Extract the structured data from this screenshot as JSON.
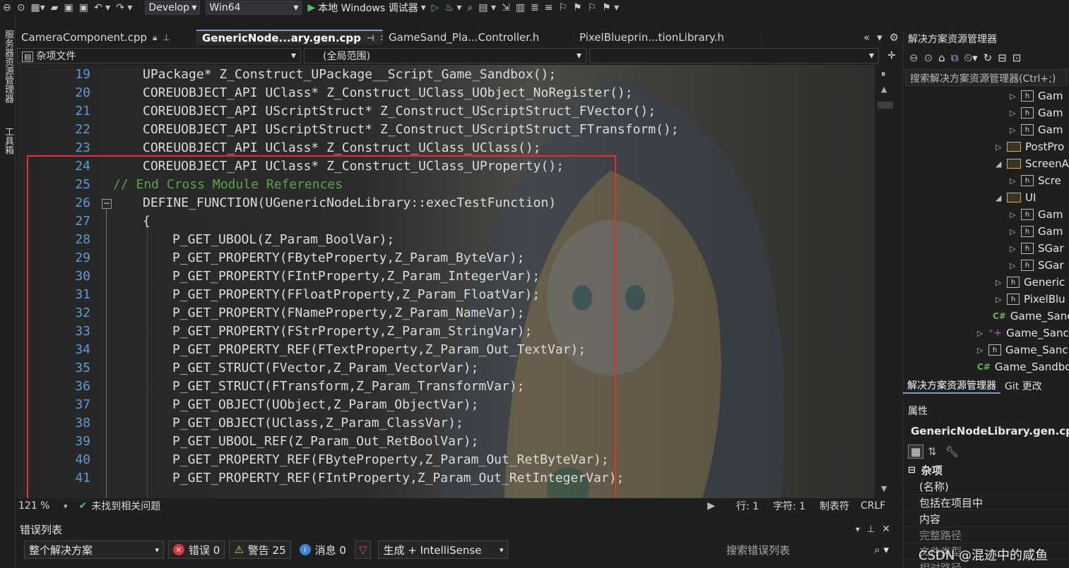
{
  "toolbar": {
    "config": "Develop",
    "platform": "Win64",
    "run_label": "本地 Windows 调试器"
  },
  "left_strip": {
    "item1": "服务器资源管理器",
    "item2": "工具箱"
  },
  "tabs": [
    {
      "label": "CameraComponent.cpp"
    },
    {
      "label": "GenericNode...ary.gen.cpp"
    },
    {
      "label": "GameSand_Pla...Controller.h"
    },
    {
      "label": "PixelBlueprin...tionLibrary.h"
    }
  ],
  "navbar": {
    "file_scope": "杂项文件",
    "global_scope": "(全局范围)"
  },
  "editor": {
    "lines": [
      {
        "n": "19",
        "code": "UPackage* Z_Construct_UPackage__Script_Game_Sandbox();"
      },
      {
        "n": "20",
        "code": "COREUOBJECT_API UClass* Z_Construct_UClass_UObject_NoRegister();"
      },
      {
        "n": "21",
        "code": "COREUOBJECT_API UScriptStruct* Z_Construct_UScriptStruct_FVector();"
      },
      {
        "n": "22",
        "code": "COREUOBJECT_API UScriptStruct* Z_Construct_UScriptStruct_FTransform();"
      },
      {
        "n": "23",
        "code": "COREUOBJECT_API UClass* Z_Construct_UClass_UClass();"
      },
      {
        "n": "24",
        "code": "COREUOBJECT_API UClass* Z_Construct_UClass_UProperty();"
      },
      {
        "n": "25",
        "code": "// End Cross Module References"
      },
      {
        "n": "26",
        "code": "DEFINE_FUNCTION(UGenericNodeLibrary::execTestFunction)"
      },
      {
        "n": "27",
        "code": "{"
      },
      {
        "n": "28",
        "code": "P_GET_UBOOL(Z_Param_BoolVar);"
      },
      {
        "n": "29",
        "code": "P_GET_PROPERTY(FByteProperty,Z_Param_ByteVar);"
      },
      {
        "n": "30",
        "code": "P_GET_PROPERTY(FIntProperty,Z_Param_IntegerVar);"
      },
      {
        "n": "31",
        "code": "P_GET_PROPERTY(FFloatProperty,Z_Param_FloatVar);"
      },
      {
        "n": "32",
        "code": "P_GET_PROPERTY(FNameProperty,Z_Param_NameVar);"
      },
      {
        "n": "33",
        "code": "P_GET_PROPERTY(FStrProperty,Z_Param_StringVar);"
      },
      {
        "n": "34",
        "code": "P_GET_PROPERTY_REF(FTextProperty,Z_Param_Out_TextVar);"
      },
      {
        "n": "35",
        "code": "P_GET_STRUCT(FVector,Z_Param_VectorVar);"
      },
      {
        "n": "36",
        "code": "P_GET_STRUCT(FTransform,Z_Param_TransformVar);"
      },
      {
        "n": "37",
        "code": "P_GET_OBJECT(UObject,Z_Param_ObjectVar);"
      },
      {
        "n": "38",
        "code": "P_GET_OBJECT(UClass,Z_Param_ClassVar);"
      },
      {
        "n": "39",
        "code": "P_GET_UBOOL_REF(Z_Param_Out_RetBoolVar);"
      },
      {
        "n": "40",
        "code": "P_GET_PROPERTY_REF(FByteProperty,Z_Param_Out_RetByteVar);"
      },
      {
        "n": "41",
        "code": "P_GET_PROPERTY_REF(FIntProperty,Z_Param_Out_RetIntegerVar);"
      }
    ]
  },
  "status": {
    "zoom": "121 %",
    "issues": "未找到相关问题",
    "line": "行: 1",
    "char": "字符: 1",
    "tab": "制表符",
    "eol": "CRLF"
  },
  "error_list": {
    "title": "错误列表",
    "scope": "整个解决方案",
    "errors": "错误 0",
    "warnings": "警告 25",
    "messages": "消息 0",
    "build": "生成 + IntelliSense",
    "search_placeholder": "搜索错误列表"
  },
  "solution_explorer": {
    "title": "解决方案资源管理器",
    "search_placeholder": "搜索解决方案资源管理器(Ctrl+;)",
    "items": [
      {
        "label": "Gam"
      },
      {
        "label": "Gam"
      },
      {
        "label": "Gam"
      },
      {
        "label": "PostPro"
      },
      {
        "label": "ScreenA"
      },
      {
        "label": "Scre"
      },
      {
        "label": "UI"
      },
      {
        "label": "Gam"
      },
      {
        "label": "Gam"
      },
      {
        "label": "SGar"
      },
      {
        "label": "SGar"
      },
      {
        "label": "Generic"
      },
      {
        "label": "PixelBlu"
      },
      {
        "label": "Game_Sanc"
      },
      {
        "label": "Game_Sanc"
      },
      {
        "label": "Game_Sanc"
      },
      {
        "label": "Game_Sandbo"
      }
    ],
    "tab1": "解决方案资源管理器",
    "tab2": "Git 更改"
  },
  "properties": {
    "title": "属性",
    "file": "GenericNodeLibrary.gen.cpp",
    "section": "杂项",
    "rows": [
      {
        "label": "(名称)"
      },
      {
        "label": "包括在项目中"
      },
      {
        "label": "内容"
      },
      {
        "label": "完整路径"
      },
      {
        "label": "文件类型"
      },
      {
        "label": "相对路径"
      }
    ]
  },
  "watermark": "CSDN @混迹中的咸鱼",
  "colors": {
    "highlight_box": "#e5302c",
    "line_number": "#5d9bd8",
    "comment": "#57a64a"
  }
}
